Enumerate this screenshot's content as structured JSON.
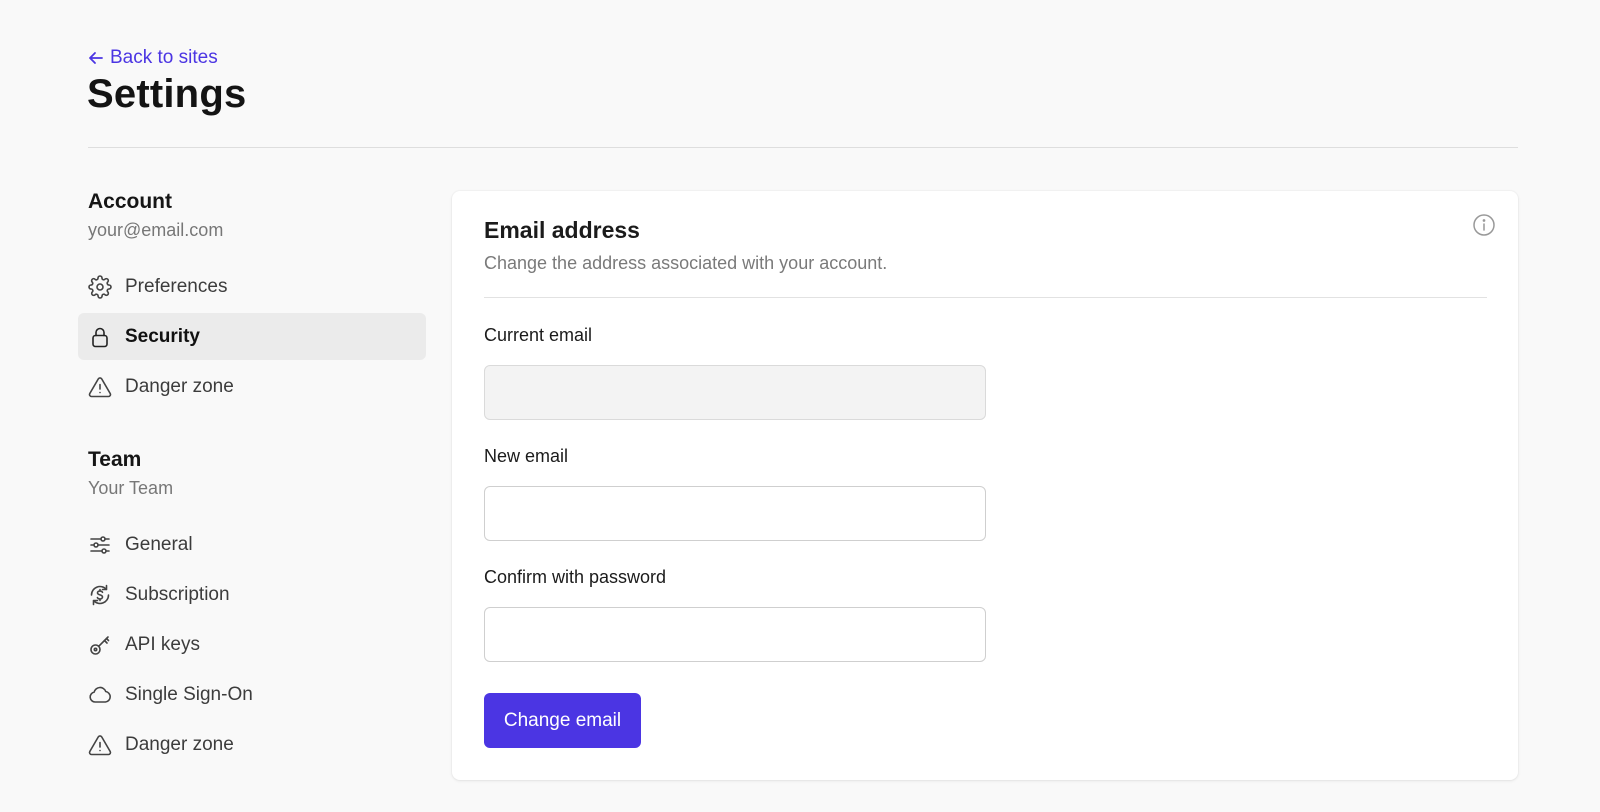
{
  "header": {
    "back_label": "Back to sites",
    "title": "Settings"
  },
  "sidebar": {
    "account": {
      "title": "Account",
      "subtitle": "your@email.com",
      "items": [
        {
          "label": "Preferences",
          "icon": "gear-icon"
        },
        {
          "label": "Security",
          "icon": "lock-icon",
          "active": true
        },
        {
          "label": "Danger zone",
          "icon": "warning-icon"
        }
      ]
    },
    "team": {
      "title": "Team",
      "subtitle": "Your Team",
      "items": [
        {
          "label": "General",
          "icon": "sliders-icon"
        },
        {
          "label": "Subscription",
          "icon": "subscription-icon"
        },
        {
          "label": "API keys",
          "icon": "key-icon"
        },
        {
          "label": "Single Sign-On",
          "icon": "cloud-icon"
        },
        {
          "label": "Danger zone",
          "icon": "warning-icon"
        }
      ]
    }
  },
  "card": {
    "title": "Email address",
    "subtitle": "Change the address associated with your account.",
    "fields": {
      "current_email": {
        "label": "Current email",
        "value": "",
        "placeholder": ""
      },
      "new_email": {
        "label": "New email",
        "value": "",
        "placeholder": ""
      },
      "password": {
        "label": "Confirm with password",
        "value": "",
        "placeholder": ""
      }
    },
    "submit_label": "Change email"
  },
  "colors": {
    "accent": "#4b35e3",
    "background": "#f9f9f9",
    "active_nav": "#ebebeb"
  }
}
